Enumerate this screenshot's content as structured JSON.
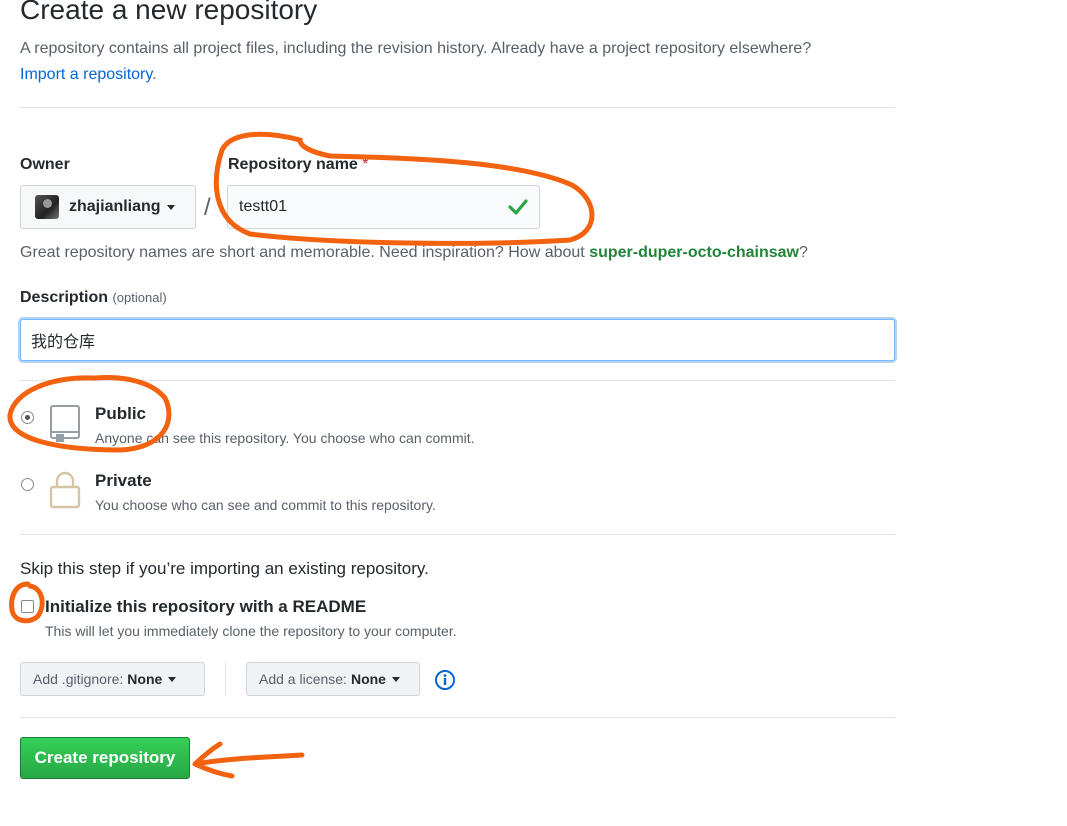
{
  "header": {
    "title": "Create a new repository",
    "subtitle": "A repository contains all project files, including the revision history. Already have a project repository elsewhere?",
    "import_link": "Import a repository",
    "import_suffix": "."
  },
  "owner": {
    "label": "Owner",
    "value": "zhajianliang"
  },
  "separator": "/",
  "repo_name": {
    "label": "Repository name",
    "required_mark": "*",
    "value": "testt01"
  },
  "hint": {
    "text": "Great repository names are short and memorable. Need inspiration? How about",
    "suggestion": "super-duper-octo-chainsaw",
    "suffix": "?"
  },
  "description": {
    "label": "Description",
    "optional": "(optional)",
    "value": "我的仓库"
  },
  "visibility": {
    "public": {
      "title": "Public",
      "desc": "Anyone can see this repository. You choose who can commit.",
      "checked": true
    },
    "private": {
      "title": "Private",
      "desc": "You choose who can see and commit to this repository.",
      "checked": false
    }
  },
  "init": {
    "skip_text": "Skip this step if you’re importing an existing repository.",
    "readme_label": "Initialize this repository with a README",
    "readme_desc": "This will let you immediately clone the repository to your computer.",
    "readme_checked": false
  },
  "gitignore": {
    "key": "Add .gitignore:",
    "value": "None"
  },
  "license": {
    "key": "Add a license:",
    "value": "None"
  },
  "submit_label": "Create repository",
  "colors": {
    "annotation": "#f2620f",
    "success": "#28a745",
    "link": "#0366d6"
  }
}
